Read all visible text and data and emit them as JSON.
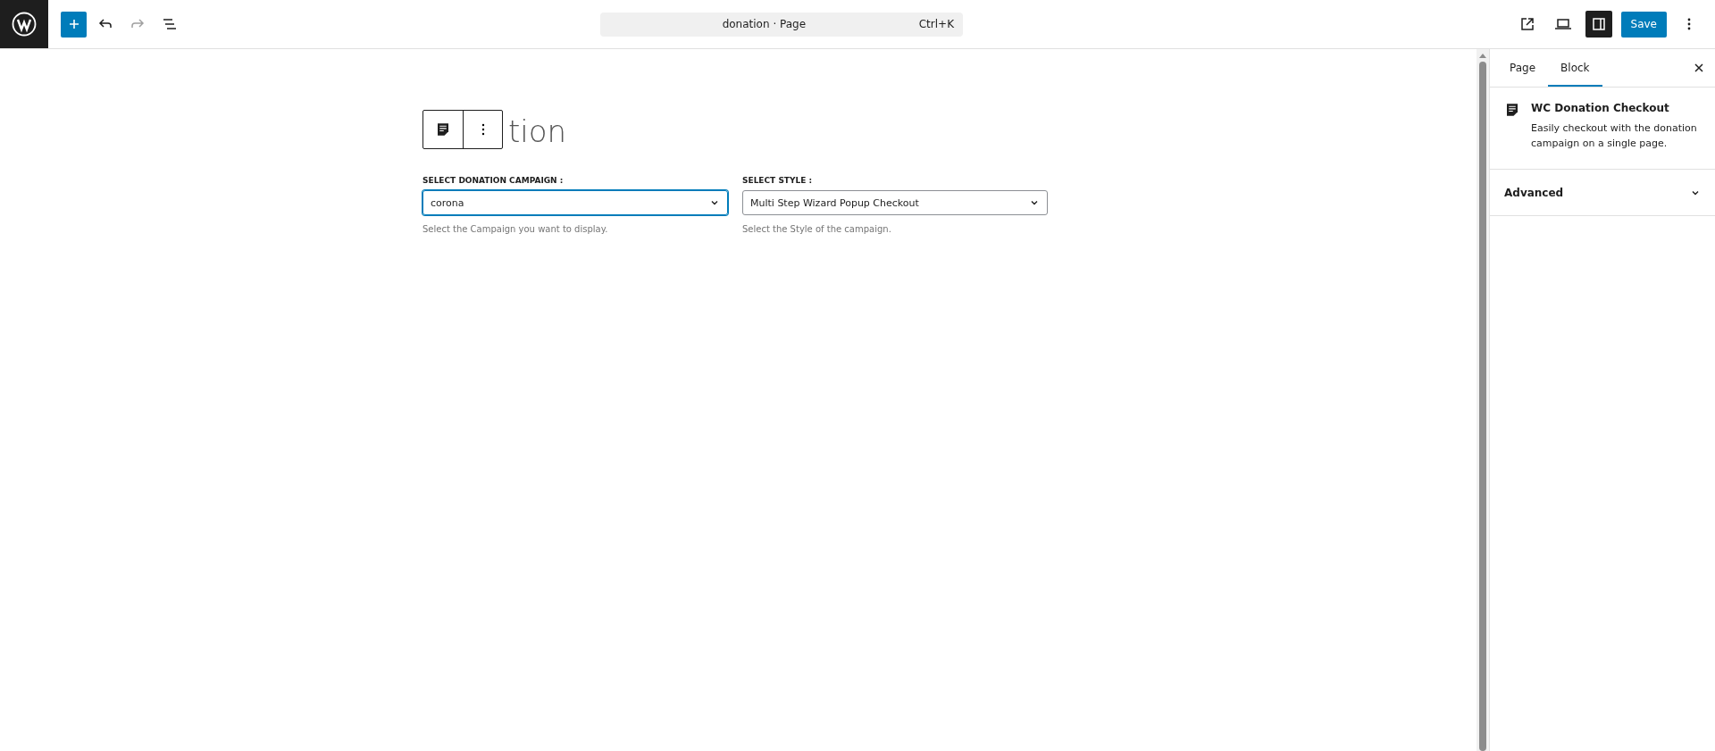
{
  "toolbar": {
    "undo": {
      "disabled": false
    },
    "redo": {
      "disabled": true
    },
    "command": {
      "title": "donation · Page",
      "shortcut": "Ctrl+K"
    },
    "settings_toggle": {
      "pressed": true
    },
    "save": "Save"
  },
  "editor": {
    "title": "tion",
    "fields": [
      {
        "label": "SELECT DONATION CAMPAIGN :",
        "value": "corona",
        "help": "Select the Campaign you want to display.",
        "focused": true
      },
      {
        "label": "SELECT STYLE :",
        "value": "Multi Step Wizard Popup Checkout",
        "help": "Select the Style of the campaign.",
        "focused": false
      }
    ]
  },
  "sidebar": {
    "tabs": [
      {
        "label": "Page",
        "selected": false
      },
      {
        "label": "Block",
        "selected": true
      }
    ],
    "block": {
      "name": "WC Donation Checkout",
      "description": "Easily checkout with the donation campaign on a single page."
    },
    "panels": [
      {
        "title": "Advanced",
        "expanded": false
      }
    ]
  }
}
